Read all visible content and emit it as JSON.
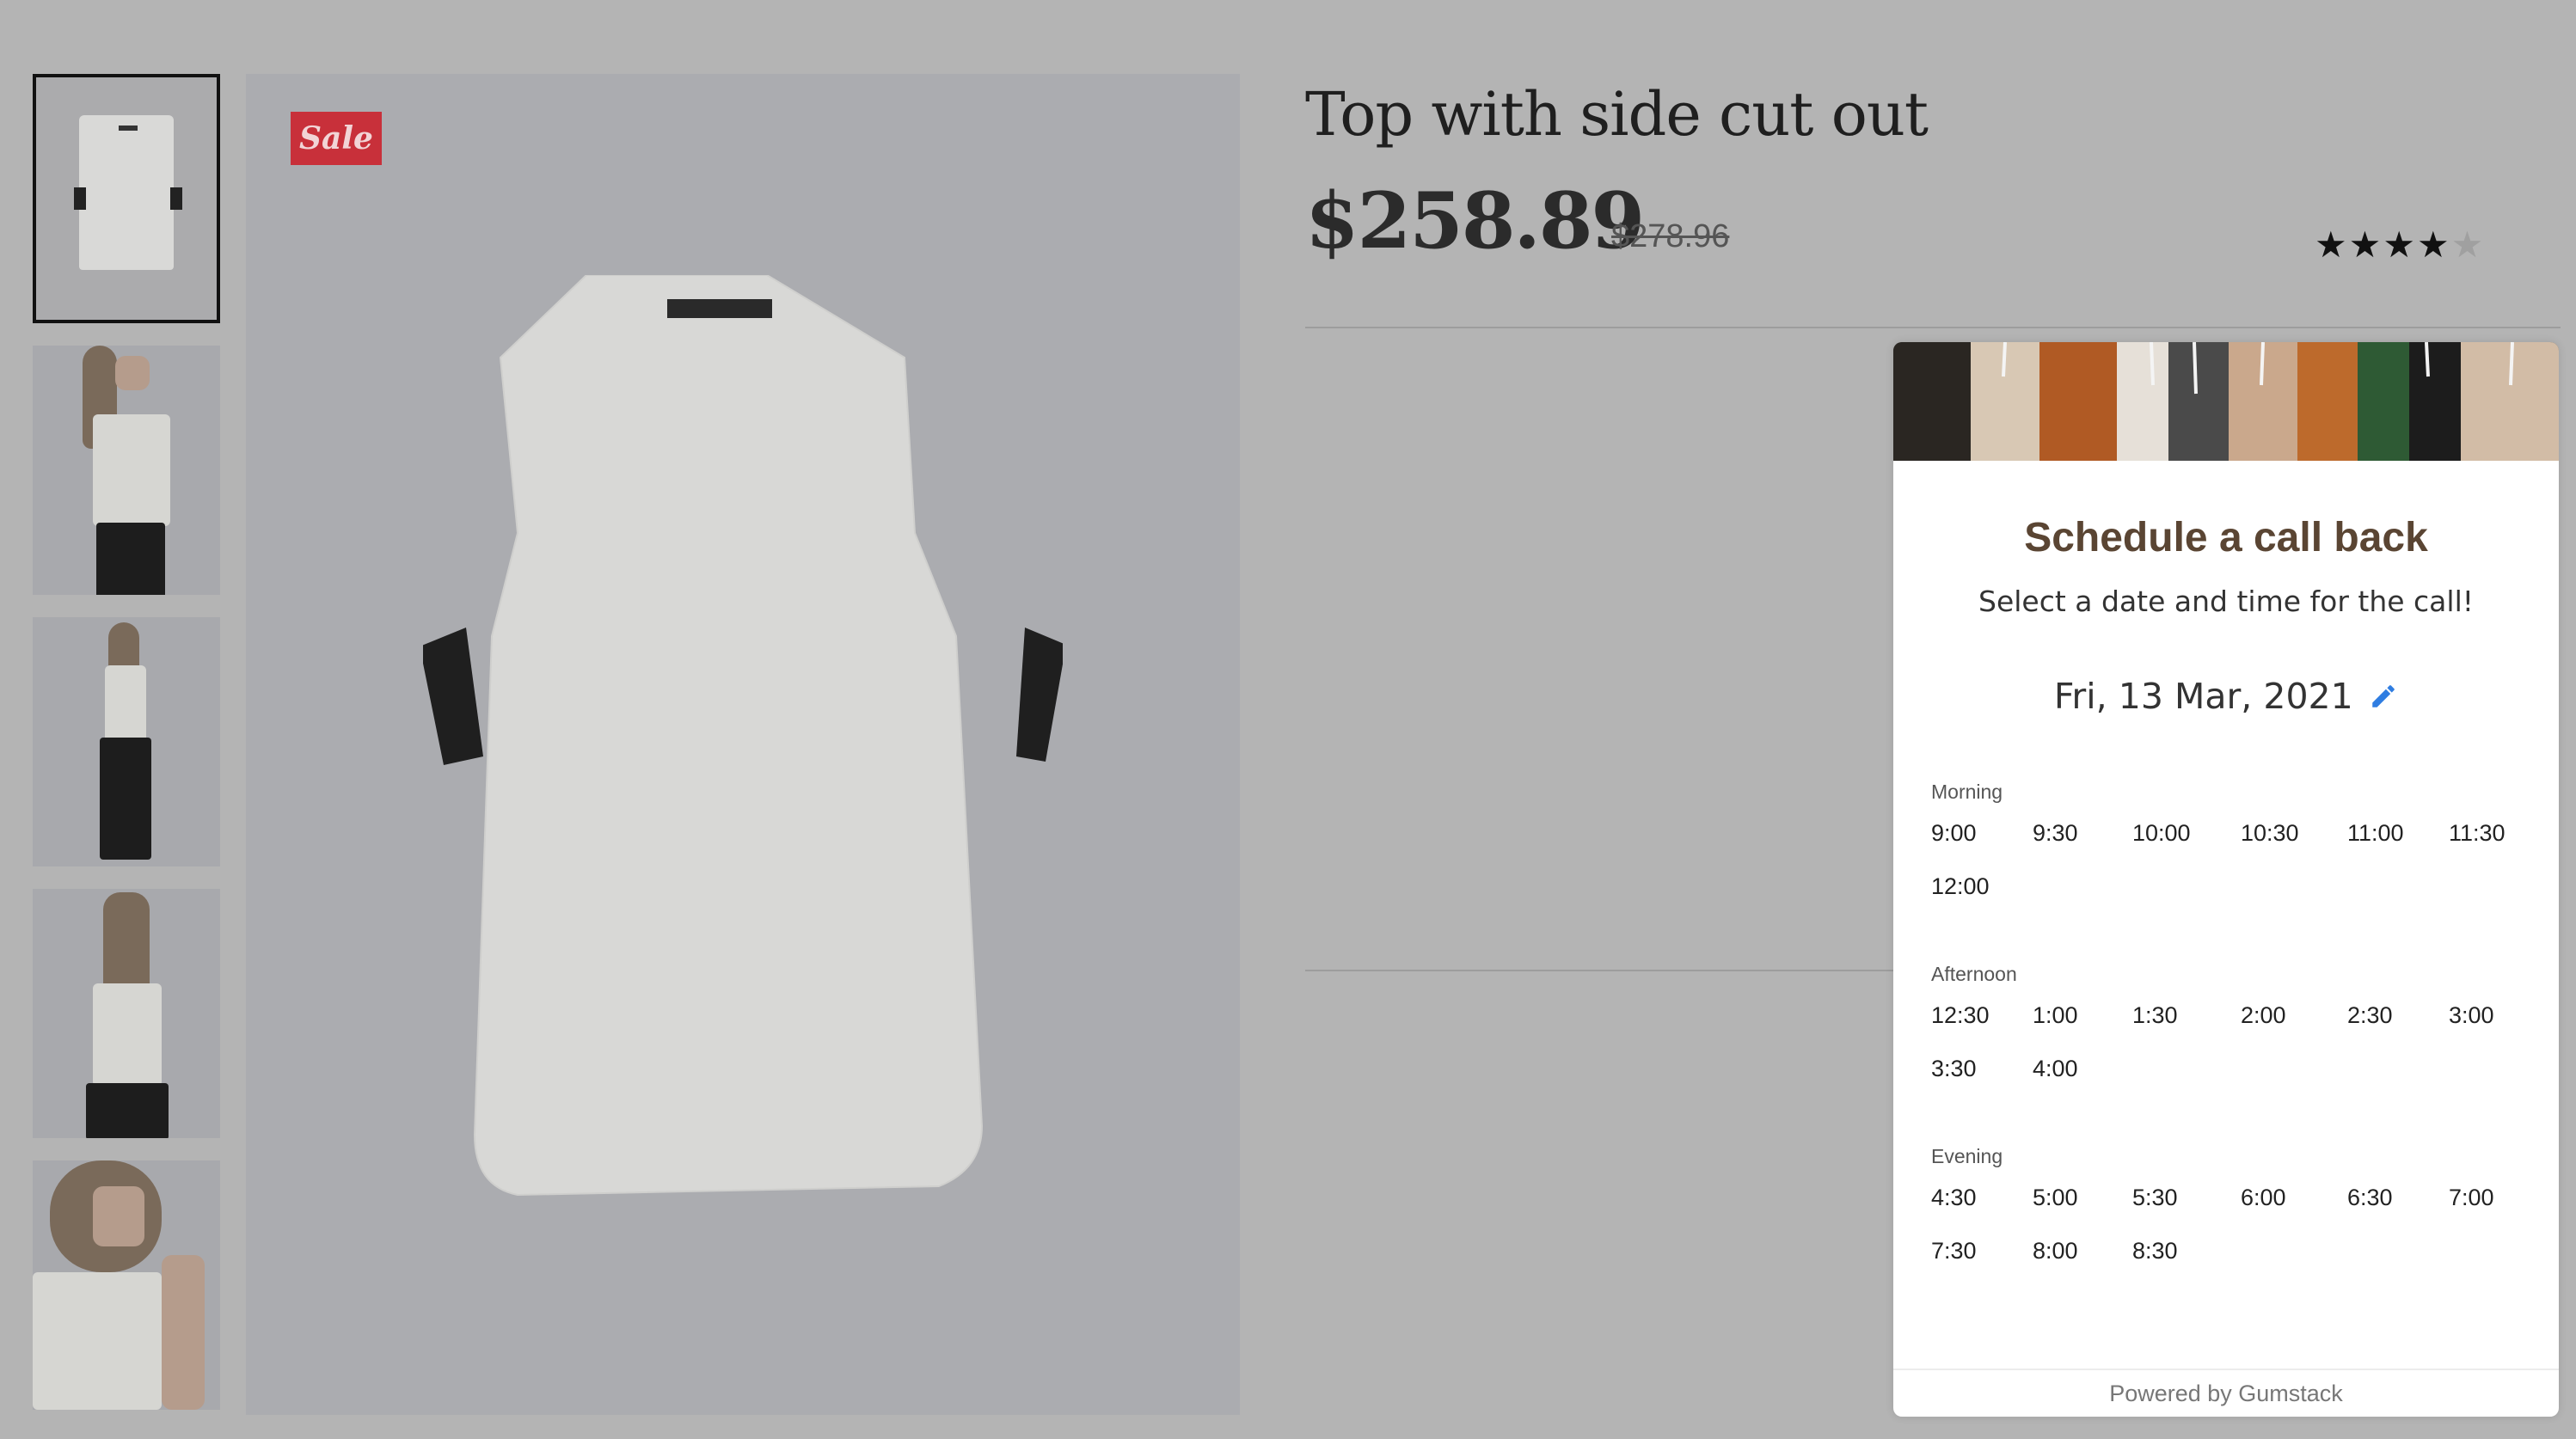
{
  "product": {
    "badge": "Sale",
    "title": "Top with side cut out",
    "price": "$258.89",
    "old_price": "$278.96",
    "rating": 4,
    "rating_max": 5
  },
  "thumbnails": [
    "thumb-front-shirt",
    "thumb-model-side",
    "thumb-model-full",
    "thumb-model-back",
    "thumb-model-closeup"
  ],
  "selected_thumbnail": 0,
  "widget": {
    "title": "Schedule a call back",
    "subtitle": "Select a date and time for the call!",
    "date": "Fri, 13 Mar, 2021",
    "sections": [
      {
        "label": "Morning",
        "slots": [
          "9:00",
          "9:30",
          "10:00",
          "10:30",
          "11:00",
          "11:30",
          "12:00"
        ]
      },
      {
        "label": "Afternoon",
        "slots": [
          "12:30",
          "1:00",
          "1:30",
          "2:00",
          "2:30",
          "3:00",
          "3:30",
          "4:00"
        ]
      },
      {
        "label": "Evening",
        "slots": [
          "4:30",
          "5:00",
          "5:30",
          "6:00",
          "6:30",
          "7:00",
          "7:30",
          "8:00",
          "8:30"
        ]
      }
    ],
    "powered_by": "Powered by Gumstack"
  },
  "colors": {
    "overlay_background": "#b4b4b4",
    "sale_badge": "#c8303a",
    "widget_title": "#5a4533",
    "edit_icon": "#2f7de1"
  },
  "icons": {
    "edit": "pencil-icon",
    "star": "star-icon"
  }
}
